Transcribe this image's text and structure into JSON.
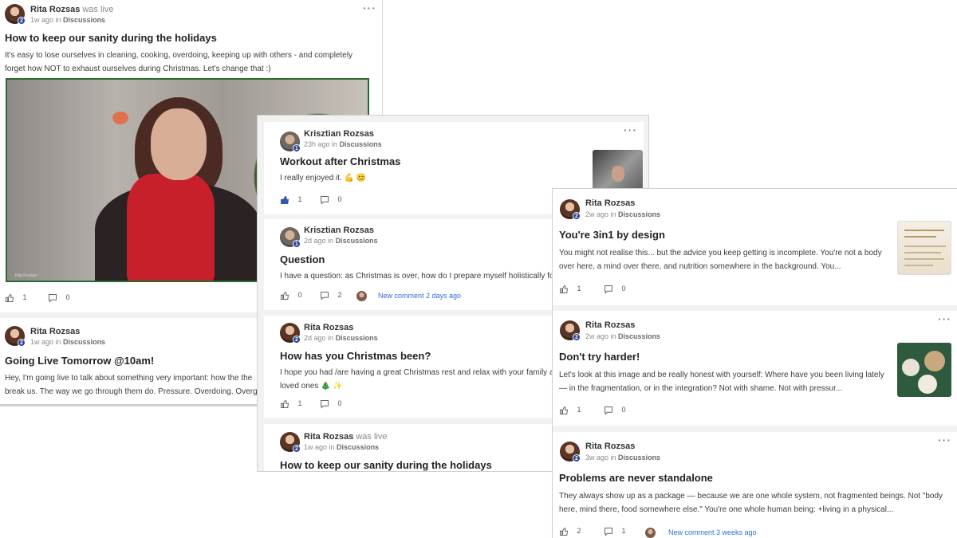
{
  "icons": {
    "like": "thumbs-up-icon",
    "comment": "speech-bubble-icon",
    "more": "ellipsis-icon"
  },
  "colors": {
    "link": "#2f6fd6",
    "badge": "#27439a",
    "liked": "#2e5aa8"
  },
  "panel1": {
    "post1": {
      "author": "Rita Rozsas",
      "author_suffix": "was live",
      "badge": "2",
      "time": "1w ago in",
      "category": "Discussions",
      "title": "How to keep our sanity during the holidays",
      "body": "It's easy to lose ourselves in cleaning, cooking, overdoing, keeping up with others - and completely forget how NOT to exhaust ourselves during Christmas. Let's change that :)",
      "video_caption": "Rita Rozsas",
      "likes": "1",
      "comments": "0"
    },
    "post2": {
      "author": "Rita Rozsas",
      "badge": "2",
      "time": "1w ago in",
      "category": "Discussions",
      "title": "Going Live Tomorrow @10am!",
      "body_line1": "Hey, I'm going live to talk about something very important: how the the",
      "body_line2": "break us. The way we go through them do. Pressure. Overdoing. Overg"
    }
  },
  "panel2": {
    "post1": {
      "author": "Krisztian Rozsas",
      "badge": "1",
      "time": "23h ago in",
      "category": "Discussions",
      "title": "Workout after Christmas",
      "body": "I really enjoyed it. 💪 😊",
      "likes": "1",
      "comments": "0"
    },
    "post2": {
      "author": "Krisztian Rozsas",
      "badge": "1",
      "time": "2d ago in",
      "category": "Discussions",
      "title": "Question",
      "body": "I have a question: as Christmas is over, how do I prepare myself holistically for t",
      "likes": "0",
      "comments": "2",
      "new_comment": "New comment 2 days ago"
    },
    "post3": {
      "author": "Rita Rozsas",
      "badge": "2",
      "time": "2d ago in",
      "category": "Discussions",
      "title": "How has you Christmas been?",
      "body_line1": "I hope you had /are having a great Christmas rest and relax with your family anc",
      "body_line2": "loved ones 🎄 ✨",
      "likes": "1",
      "comments": "0"
    },
    "post4": {
      "author": "Rita Rozsas",
      "author_suffix": "was live",
      "badge": "2",
      "time": "1w ago in",
      "category": "Discussions",
      "title": "How to keep our sanity during the holidays"
    }
  },
  "panel3": {
    "post1": {
      "author": "Rita Rozsas",
      "badge": "2",
      "time": "2w ago in",
      "category": "Discussions",
      "title": "You're 3in1 by design",
      "body": "You might not realise this... but the advice you keep getting is incomplete. You're not a body over here, a mind over there, and nutrition somewhere in the background. You...",
      "likes": "1",
      "comments": "0"
    },
    "post2": {
      "author": "Rita Rozsas",
      "badge": "2",
      "time": "2w ago in",
      "category": "Discussions",
      "title": "Don't try harder!",
      "body": "Let's look at this image and be really honest with yourself: Where have you been living lately — in the fragmentation, or in the integration? Not with shame. Not with pressur...",
      "likes": "1",
      "comments": "0"
    },
    "post3": {
      "author": "Rita Rozsas",
      "badge": "2",
      "time": "3w ago in",
      "category": "Discussions",
      "title": "Problems are never standalone",
      "body": "They always show up as a package — because we are one whole system, not fragmented beings. Not \"body here, mind there, food somewhere else.\" You're one whole human being: +living in a physical...",
      "likes": "2",
      "comments": "1",
      "new_comment": "New comment 3 weeks ago"
    }
  }
}
